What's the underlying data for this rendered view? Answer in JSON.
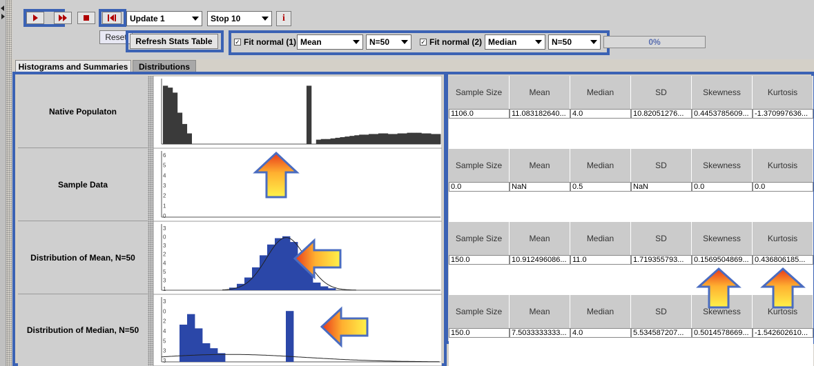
{
  "toolbar": {
    "update_value": "Update 1",
    "stop_value": "Stop 10",
    "info_label": "i",
    "reset_label": "Reset",
    "refresh_label": "Refresh Stats Table",
    "fit1_label": "Fit normal (1)",
    "fit1_stat": "Mean",
    "fit1_n": "N=50",
    "fit2_label": "Fit normal (2)",
    "fit2_stat": "Median",
    "fit2_n": "N=50",
    "progress_text": "0%",
    "progress_fraction": 0
  },
  "tabs": [
    {
      "label": "Histograms and Summaries"
    },
    {
      "label": "Distributions"
    }
  ],
  "rows": [
    {
      "label": "Native Populaton"
    },
    {
      "label": "Sample Data"
    },
    {
      "label": "Distribution of Mean, N=50"
    },
    {
      "label": "Distribution of Median, N=50"
    }
  ],
  "stats_headers": [
    "Sample Size",
    "Mean",
    "Median",
    "SD",
    "Skewness",
    "Kurtosis"
  ],
  "stats_tables": [
    [
      "1106.0",
      "11.083182640...",
      "4.0",
      "10.82051276...",
      "0.4453785609...",
      "-1.370997636..."
    ],
    [
      "0.0",
      "NaN",
      "0.5",
      "NaN",
      "0.0",
      "0.0"
    ],
    [
      "150.0",
      "10.912496086...",
      "11.0",
      "1.719355793...",
      "0.1569504869...",
      "0.436806185..."
    ],
    [
      "150.0",
      "7.5033333333...",
      "4.0",
      "5.534587207...",
      "0.5014578669...",
      "-1.542602610..."
    ]
  ],
  "chart_data": [
    {
      "type": "bar",
      "name_of_panel": "Native Populaton",
      "relative_heights": [
        0.93,
        0.9,
        0.82,
        0.5,
        0.32,
        0.17,
        0,
        0,
        0,
        0,
        0,
        0,
        0,
        0,
        0,
        0,
        0,
        0,
        0,
        0,
        0,
        0,
        0,
        0,
        0,
        0,
        0,
        0,
        0,
        0,
        0.93,
        0,
        0.07,
        0.08,
        0.08,
        0.09,
        0.1,
        0.11,
        0.12,
        0.13,
        0.14,
        0.15,
        0.15,
        0.16,
        0.16,
        0.17,
        0.17,
        0.16,
        0.16,
        0.17,
        0.17,
        0.18,
        0.18,
        0.18,
        0.17,
        0.17,
        0.16,
        0.16
      ],
      "color": "#3a3a3a"
    },
    {
      "type": "bar",
      "name_of_panel": "Sample Data",
      "y_ticks": [
        "6",
        "5",
        "4",
        "3",
        "2",
        "1",
        "0"
      ],
      "relative_heights": []
    },
    {
      "type": "bar",
      "name_of_panel": "Distribution of Mean, N=50",
      "y_ticks": [
        "3",
        "0",
        "3",
        "2",
        "4",
        "5",
        "3",
        "1"
      ],
      "relative_heights": [
        0.04,
        0.1,
        0.2,
        0.36,
        0.55,
        0.72,
        0.82,
        0.85,
        0.76,
        0.55,
        0.33,
        0.12,
        0.06,
        0.03
      ],
      "curve": "normal",
      "color": "#2b47a8"
    },
    {
      "type": "bar",
      "name_of_panel": "Distribution of Median, N=50",
      "y_ticks": [
        "3",
        "0",
        "2",
        "4",
        "5",
        "3",
        "3"
      ],
      "relative_heights": [
        0.6,
        0.77,
        0.54,
        0.3,
        0.22,
        0.14,
        0,
        0,
        0,
        0,
        0,
        0,
        0,
        0,
        0.82
      ],
      "curve": "normal-flat",
      "color": "#2b47a8"
    }
  ],
  "colors": {
    "highlight": "#3b62b4",
    "bar_dark": "#3a3a3a",
    "bar_blue": "#2b47a8",
    "arrow_outline": "#4a6cc0"
  }
}
